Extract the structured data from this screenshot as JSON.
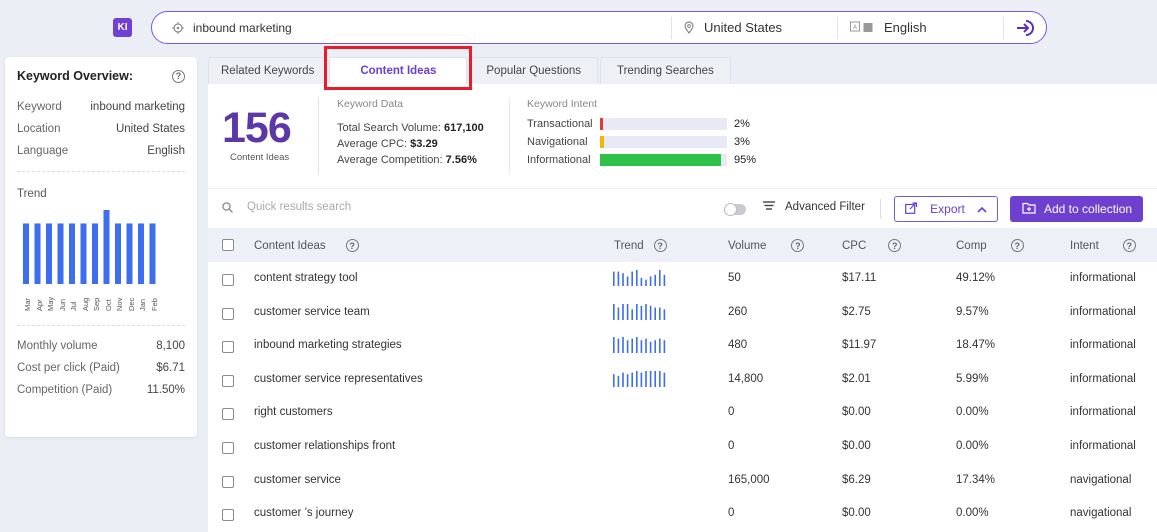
{
  "app": {
    "logo_text": "KI"
  },
  "search": {
    "keyword": "inbound marketing",
    "location": "United States",
    "language": "English"
  },
  "overview": {
    "title": "Keyword Overview:",
    "rows": [
      {
        "label": "Keyword",
        "value": "inbound marketing"
      },
      {
        "label": "Location",
        "value": "United States"
      },
      {
        "label": "Language",
        "value": "English"
      }
    ],
    "trend_label": "Trend",
    "trend": {
      "months": [
        "Mar",
        "Apr",
        "May",
        "Jun",
        "Jul",
        "Aug",
        "Sep",
        "Oct",
        "Nov",
        "Dec",
        "Jan",
        "Feb"
      ],
      "values": [
        8100,
        8100,
        8100,
        8100,
        8100,
        8100,
        8100,
        9900,
        8100,
        8100,
        8100,
        8100
      ],
      "color": "#3d6ef0"
    },
    "stats": [
      {
        "label": "Monthly volume",
        "value": "8,100"
      },
      {
        "label": "Cost per click (Paid)",
        "value": "$6.71"
      },
      {
        "label": "Competition (Paid)",
        "value": "11.50%"
      }
    ]
  },
  "tabs": [
    {
      "label": "Related Keywords",
      "active": false
    },
    {
      "label": "Content Ideas",
      "active": true
    },
    {
      "label": "Popular Questions",
      "active": false
    },
    {
      "label": "Trending Searches",
      "active": false
    }
  ],
  "summary": {
    "count": "156",
    "count_label": "Content Ideas",
    "keyword_data": {
      "heading": "Keyword Data",
      "total_search_volume_label": "Total Search Volume:",
      "total_search_volume": "617,100",
      "avg_cpc_label": "Average CPC:",
      "avg_cpc": "$3.29",
      "avg_comp_label": "Average Competition:",
      "avg_comp": "7.56%"
    },
    "keyword_intent": {
      "heading": "Keyword Intent",
      "items": [
        {
          "label": "Transactional",
          "pct": "2%",
          "fraction": 0.02,
          "color": "#e53935"
        },
        {
          "label": "Navigational",
          "pct": "3%",
          "fraction": 0.03,
          "color": "#f5b400"
        },
        {
          "label": "Informational",
          "pct": "95%",
          "fraction": 0.95,
          "color": "#2ec24a"
        }
      ]
    }
  },
  "toolbar": {
    "quick_search_placeholder": "Quick results search",
    "advanced_filter": "Advanced Filter",
    "export": "Export",
    "add_to_collection": "Add to collection"
  },
  "table": {
    "headers": {
      "content_ideas": "Content Ideas",
      "trend": "Trend",
      "volume": "Volume",
      "cpc": "CPC",
      "comp": "Comp",
      "intent": "Intent"
    },
    "rows": [
      {
        "idea": "content strategy tool",
        "volume": "50",
        "cpc": "$17.11",
        "comp": "49.12%",
        "intent": "informational",
        "trend": [
          9,
          9,
          8,
          6,
          9,
          10,
          5,
          4,
          6,
          7,
          10,
          7
        ]
      },
      {
        "idea": "customer service team",
        "volume": "260",
        "cpc": "$2.75",
        "comp": "9.57%",
        "intent": "informational",
        "trend": [
          9,
          7,
          9,
          9,
          6,
          9,
          8,
          9,
          8,
          7,
          7,
          6
        ]
      },
      {
        "idea": "inbound marketing strategies",
        "volume": "480",
        "cpc": "$11.97",
        "comp": "18.47%",
        "intent": "informational",
        "trend": [
          10,
          9,
          10,
          8,
          9,
          10,
          8,
          9,
          7,
          8,
          9,
          8
        ]
      },
      {
        "idea": "customer service representatives",
        "volume": "14,800",
        "cpc": "$2.01",
        "comp": "5.99%",
        "intent": "informational",
        "trend": [
          8,
          7,
          9,
          8,
          9,
          10,
          9,
          10,
          10,
          10,
          10,
          9
        ]
      },
      {
        "idea": "right customers",
        "volume": "0",
        "cpc": "$0.00",
        "comp": "0.00%",
        "intent": "informational",
        "trend": []
      },
      {
        "idea": "customer relationships front",
        "volume": "0",
        "cpc": "$0.00",
        "comp": "0.00%",
        "intent": "informational",
        "trend": []
      },
      {
        "idea": "customer service",
        "volume": "165,000",
        "cpc": "$6.29",
        "comp": "17.34%",
        "intent": "navigational",
        "trend": []
      },
      {
        "idea": "customer ’s journey",
        "volume": "0",
        "cpc": "$0.00",
        "comp": "0.00%",
        "intent": "navigational",
        "trend": []
      }
    ]
  }
}
